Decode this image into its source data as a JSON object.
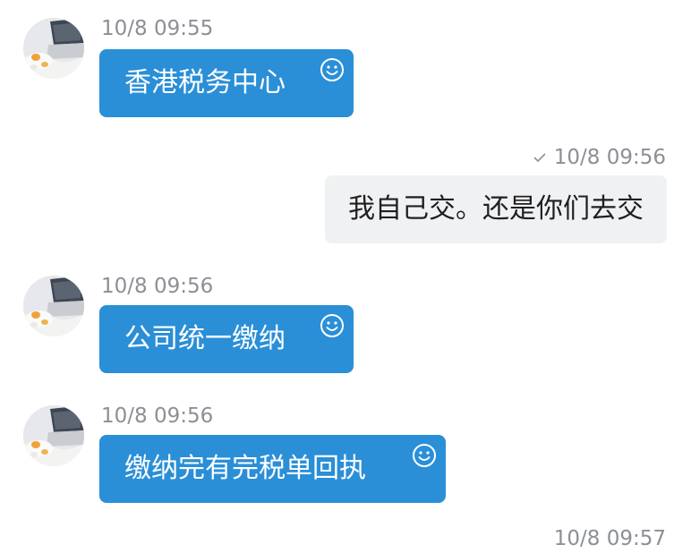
{
  "messages": [
    {
      "id": "m1",
      "side": "incoming",
      "time": "10/8 09:55",
      "text": "香港税务中心"
    },
    {
      "id": "m2",
      "side": "outgoing",
      "time": "10/8 09:56",
      "text": "我自己交。还是你们去交"
    },
    {
      "id": "m3",
      "side": "incoming",
      "time": "10/8 09:56",
      "text": "公司统一缴纳"
    },
    {
      "id": "m4",
      "side": "incoming",
      "time": "10/8 09:56",
      "text": "缴纳完有完税单回执"
    },
    {
      "id": "m5",
      "side": "outgoing",
      "time": "10/8 09:57",
      "text": ""
    }
  ],
  "colors": {
    "incoming_bubble": "#2a8fd7",
    "outgoing_bubble": "#f0f1f3",
    "timestamp": "#8c8f95"
  },
  "icons": {
    "reaction": "smiley-icon",
    "delivered": "checkmark-icon",
    "avatar": "laptop-photo-avatar"
  }
}
